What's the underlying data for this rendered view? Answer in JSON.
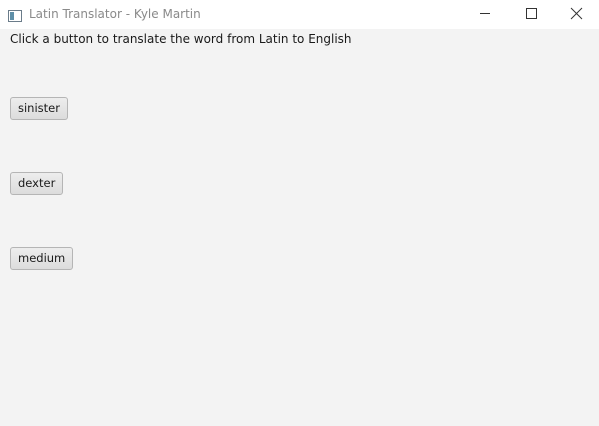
{
  "window": {
    "title": "Latin Translator - Kyle Martin",
    "icon": "app-window-icon",
    "controls": [
      "minimize-icon",
      "maximize-icon",
      "close-icon"
    ]
  },
  "content": {
    "instruction": "Click a button to translate the word from Latin to English",
    "buttons": [
      {
        "label": "sinister"
      },
      {
        "label": "dexter"
      },
      {
        "label": "medium"
      }
    ]
  }
}
